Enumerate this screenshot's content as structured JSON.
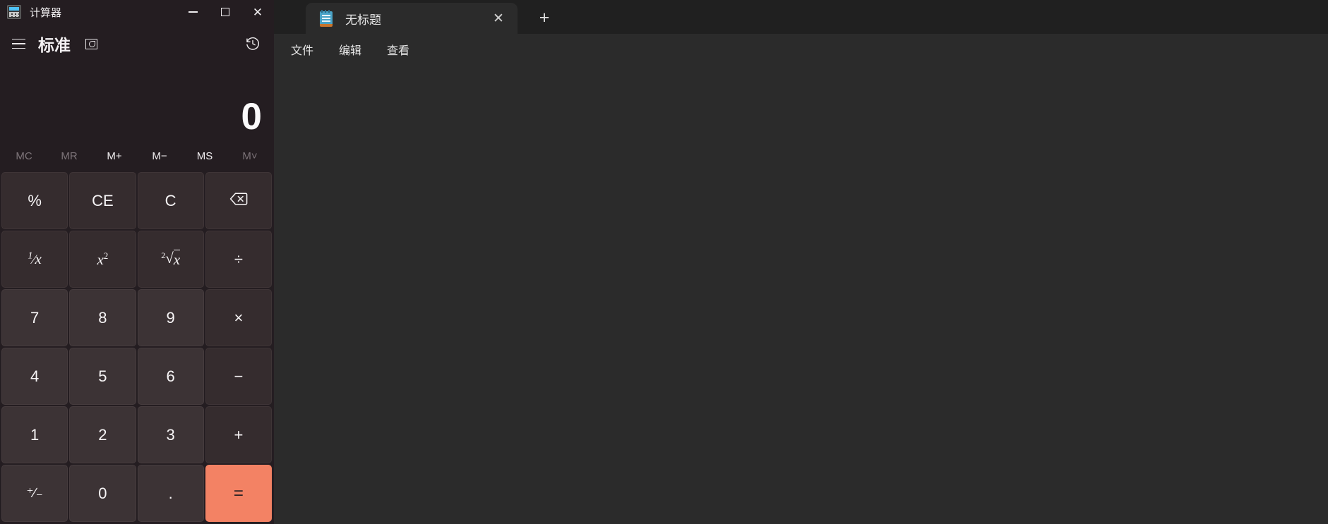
{
  "notepad": {
    "tab": {
      "icon": "notepad-icon",
      "title": "无标题",
      "close_label": "✕",
      "new_tab_label": "+"
    },
    "menu": [
      {
        "label": "文件",
        "name": "file"
      },
      {
        "label": "编辑",
        "name": "edit"
      },
      {
        "label": "查看",
        "name": "view"
      }
    ],
    "editor": {
      "content": "",
      "placeholder": ""
    },
    "colors": {
      "chrome": "#202020",
      "surface": "#2b2b2b",
      "text": "#e8e8e8"
    }
  },
  "calculator": {
    "window": {
      "title": "计算器",
      "icon": "calculator-icon",
      "minimize_label": "—",
      "maximize_label": "□",
      "close_label": "✕"
    },
    "header": {
      "menu_label": "☰",
      "mode": "标准",
      "keep_on_top_label": "keep-on-top",
      "history_label": "history"
    },
    "display": {
      "value": "0",
      "expression": ""
    },
    "memory": [
      {
        "label": "MC",
        "name": "memory-clear",
        "disabled": true
      },
      {
        "label": "MR",
        "name": "memory-recall",
        "disabled": true
      },
      {
        "label": "M+",
        "name": "memory-add",
        "disabled": false
      },
      {
        "label": "M−",
        "name": "memory-subtract",
        "disabled": false
      },
      {
        "label": "MS",
        "name": "memory-store",
        "disabled": false
      },
      {
        "label": "M˅",
        "name": "memory-dropdown",
        "disabled": true
      }
    ],
    "keys": [
      {
        "label": "%",
        "name": "percent",
        "kind": "op"
      },
      {
        "label": "CE",
        "name": "clear-entry",
        "kind": "op"
      },
      {
        "label": "C",
        "name": "clear",
        "kind": "op"
      },
      {
        "label": "⌫",
        "name": "backspace",
        "kind": "backspace"
      },
      {
        "label": "¹∕x",
        "name": "reciprocal",
        "kind": "fn"
      },
      {
        "label": "x²",
        "name": "square",
        "kind": "square"
      },
      {
        "label": "²√x",
        "name": "square-root",
        "kind": "sqrt"
      },
      {
        "label": "÷",
        "name": "divide",
        "kind": "op"
      },
      {
        "label": "7",
        "name": "seven",
        "kind": "num"
      },
      {
        "label": "8",
        "name": "eight",
        "kind": "num"
      },
      {
        "label": "9",
        "name": "nine",
        "kind": "num"
      },
      {
        "label": "×",
        "name": "multiply",
        "kind": "op"
      },
      {
        "label": "4",
        "name": "four",
        "kind": "num"
      },
      {
        "label": "5",
        "name": "five",
        "kind": "num"
      },
      {
        "label": "6",
        "name": "six",
        "kind": "num"
      },
      {
        "label": "−",
        "name": "subtract",
        "kind": "op"
      },
      {
        "label": "1",
        "name": "one",
        "kind": "num"
      },
      {
        "label": "2",
        "name": "two",
        "kind": "num"
      },
      {
        "label": "3",
        "name": "three",
        "kind": "num"
      },
      {
        "label": "+",
        "name": "add",
        "kind": "op"
      },
      {
        "label": "⁺∕₋",
        "name": "plus-minus",
        "kind": "plusminus"
      },
      {
        "label": "0",
        "name": "zero",
        "kind": "num"
      },
      {
        "label": ".",
        "name": "decimal",
        "kind": "num"
      },
      {
        "label": "=",
        "name": "equals",
        "kind": "equals"
      }
    ],
    "colors": {
      "background": "#241d21",
      "key": "#3c3335",
      "key_operator": "#352c2e",
      "equals": "#f38264",
      "text": "#f7f5f6",
      "text_disabled": "#7d7479"
    }
  }
}
